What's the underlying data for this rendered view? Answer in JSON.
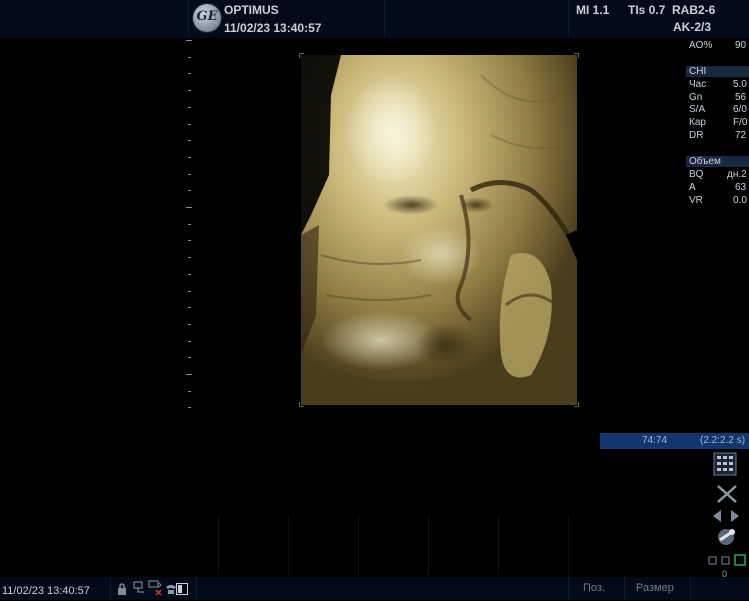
{
  "header": {
    "system_name": "OPTIMUS",
    "datetime": "11/02/23 13:40:57",
    "mi": "MI 1.1",
    "tis": "TIs 0.7",
    "probe": "RAB2-6",
    "preset": "AK-2/3"
  },
  "params": {
    "ao": {
      "label": "AO%",
      "value": "90"
    },
    "section1_title": "CHI",
    "freq": {
      "label": "Час",
      "value": "5.0"
    },
    "gain": {
      "label": "Gn",
      "value": "56"
    },
    "sa": {
      "label": "S/A",
      "value": "6/0"
    },
    "map": {
      "label": "Кар",
      "value": "F/0"
    },
    "dr": {
      "label": "DR",
      "value": "72"
    },
    "section2_title": "Объем",
    "bq": {
      "label": "BQ",
      "value": "дн.2"
    },
    "angle": {
      "label": "A",
      "value": "63"
    },
    "vr": {
      "label": "VR",
      "value": "0.0"
    }
  },
  "cine": {
    "frames": "74:74",
    "timing": "(2.2:2.2 s)",
    "progress": 1.0
  },
  "right_tools": {
    "zoom_counter": "0"
  },
  "footer": {
    "datetime": "11/02/23 13:40:57",
    "button_position": "Поз.",
    "button_size": "Размер"
  },
  "colors": {
    "header_bg": "#030b18",
    "cine_bar": "#0e2a57",
    "render_tint": "#d9c98a"
  },
  "icons": [
    "lock-icon",
    "network-icon",
    "network-error-icon",
    "phone-icon",
    "display-icon",
    "keypad-icon",
    "scissors-icon",
    "arrows-icon",
    "probe-icon",
    "layout-icon"
  ]
}
